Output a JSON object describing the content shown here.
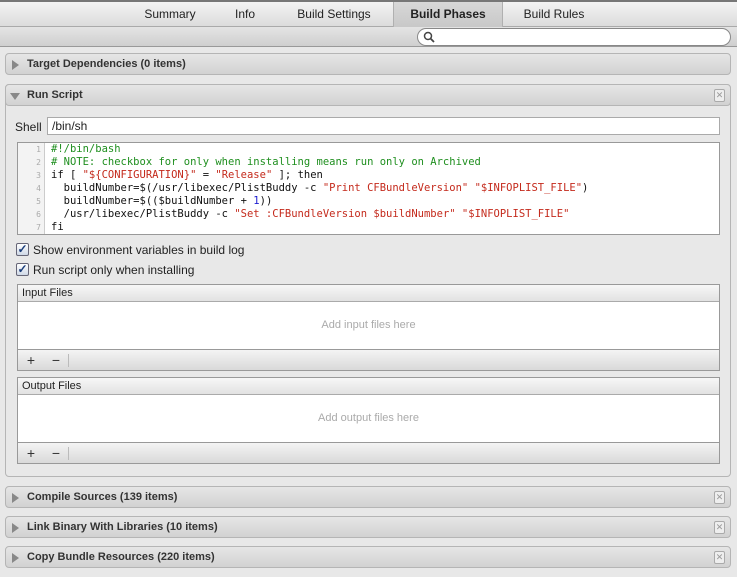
{
  "tabs": [
    {
      "label": "Summary"
    },
    {
      "label": "Info"
    },
    {
      "label": "Build Settings"
    },
    {
      "label": "Build Phases",
      "selected": true
    },
    {
      "label": "Build Rules"
    }
  ],
  "search": {
    "value": "",
    "placeholder": ""
  },
  "phases": {
    "target_dependencies": "Target Dependencies (0 items)",
    "run_script": "Run Script",
    "compile_sources": "Compile Sources (139 items)",
    "link_binary": "Link Binary With Libraries (10 items)",
    "copy_bundle": "Copy Bundle Resources (220 items)"
  },
  "run_script": {
    "shell_label": "Shell",
    "shell_value": "/bin/sh",
    "line_numbers": [
      "1",
      "2",
      "3",
      "4",
      "5",
      "6",
      "7"
    ],
    "code": [
      [
        {
          "t": "comment",
          "s": "#!/bin/bash"
        }
      ],
      [
        {
          "t": "comment",
          "s": "# NOTE: checkbox for only when installing means run only on Archived"
        }
      ],
      [
        {
          "t": "plain",
          "s": "if [ "
        },
        {
          "t": "string",
          "s": "\"${CONFIGURATION}\""
        },
        {
          "t": "plain",
          "s": " = "
        },
        {
          "t": "string",
          "s": "\"Release\""
        },
        {
          "t": "plain",
          "s": " ]; then"
        }
      ],
      [
        {
          "t": "plain",
          "s": "  buildNumber=$(/usr/libexec/PlistBuddy -c "
        },
        {
          "t": "string",
          "s": "\"Print CFBundleVersion\""
        },
        {
          "t": "plain",
          "s": " "
        },
        {
          "t": "string",
          "s": "\"$INFOPLIST_FILE\""
        },
        {
          "t": "plain",
          "s": ")"
        }
      ],
      [
        {
          "t": "plain",
          "s": "  buildNumber=$(($buildNumber + "
        },
        {
          "t": "number",
          "s": "1"
        },
        {
          "t": "plain",
          "s": "))"
        }
      ],
      [
        {
          "t": "plain",
          "s": "  /usr/libexec/PlistBuddy -c "
        },
        {
          "t": "string",
          "s": "\"Set :CFBundleVersion $buildNumber\""
        },
        {
          "t": "plain",
          "s": " "
        },
        {
          "t": "string",
          "s": "\"$INFOPLIST_FILE\""
        }
      ],
      [
        {
          "t": "plain",
          "s": "fi"
        }
      ]
    ],
    "show_env_label": "Show environment variables in build log",
    "show_env_checked": true,
    "only_installing_label": "Run script only when installing",
    "only_installing_checked": true,
    "input_files": {
      "title": "Input Files",
      "placeholder": "Add input files here",
      "add": "+",
      "remove": "−"
    },
    "output_files": {
      "title": "Output Files",
      "placeholder": "Add output files here",
      "add": "+",
      "remove": "−"
    }
  },
  "icons": {
    "search": "magnifier-icon",
    "close": "x-box-icon",
    "disclosure": "triangle-icon"
  },
  "colors": {
    "comment": "#1f8f1f",
    "string": "#c42a1c",
    "number": "#1c1ccf"
  }
}
